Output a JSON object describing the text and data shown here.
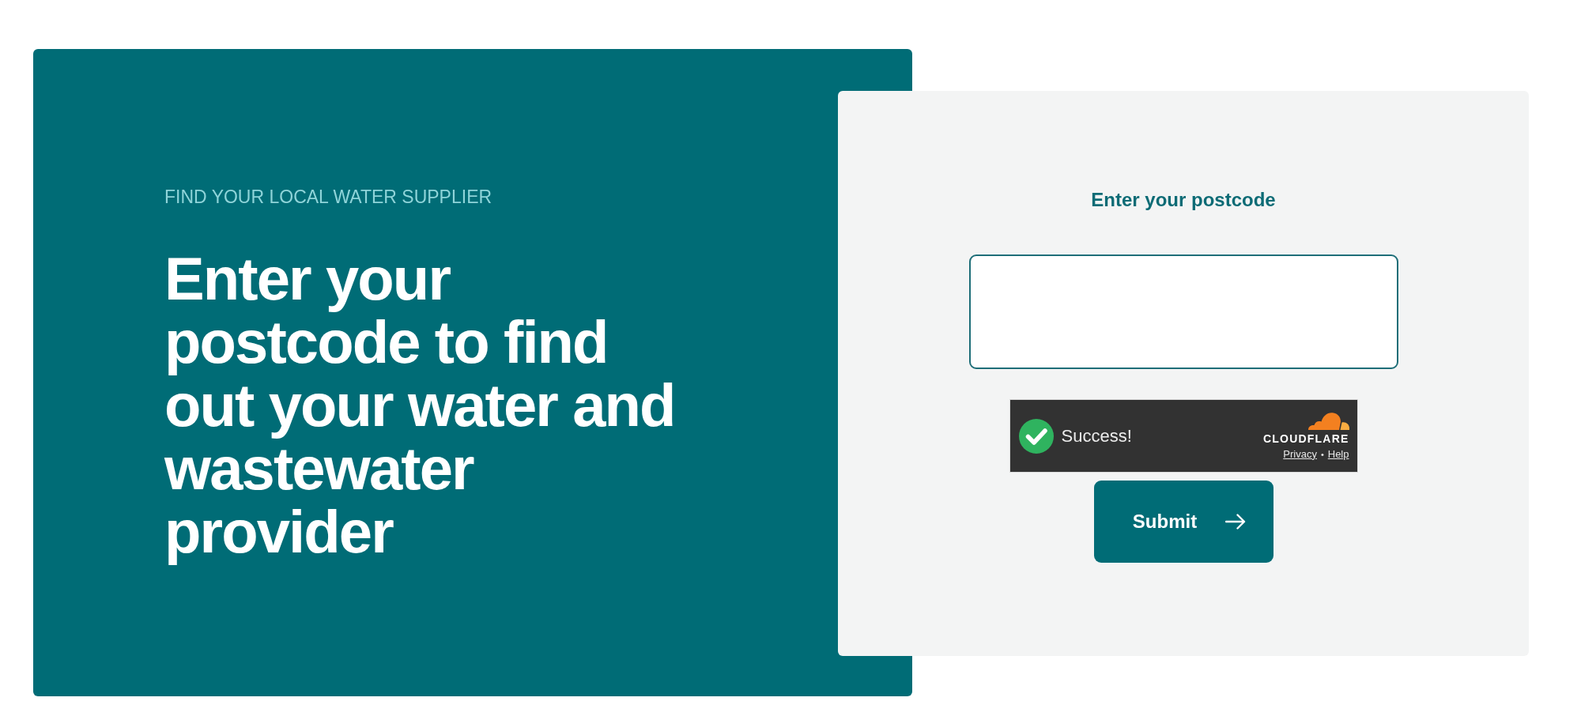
{
  "hero": {
    "eyebrow": "FIND YOUR LOCAL WATER SUPPLIER",
    "heading": "Enter your postcode to find out your water and wastewater provider"
  },
  "form": {
    "label": "Enter your postcode",
    "captcha": {
      "verified": true,
      "status": "Success!",
      "brand": "CLOUDFLARE",
      "links": [
        {
          "label": "Privacy"
        },
        {
          "label": "Help"
        }
      ],
      "separator": "•"
    },
    "submit": {
      "label": "Submit"
    }
  }
}
